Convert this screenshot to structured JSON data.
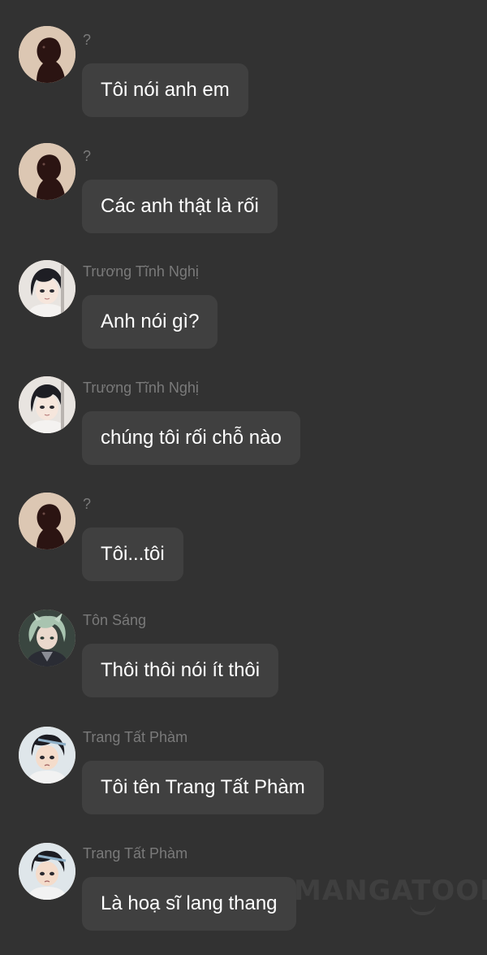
{
  "messages": [
    {
      "sender": "?",
      "text": "Tôi nói anh em",
      "avatar": "silhouette-icon"
    },
    {
      "sender": "?",
      "text": "Các anh thật là rối",
      "avatar": "silhouette-icon"
    },
    {
      "sender": "Trương Tĩnh Nghị",
      "text": "Anh nói gì?",
      "avatar": "dark-haired-character-icon"
    },
    {
      "sender": "Trương Tĩnh Nghị",
      "text": "chúng tôi rối chỗ nào",
      "avatar": "dark-haired-character-icon"
    },
    {
      "sender": "?",
      "text": "Tôi...tôi",
      "avatar": "silhouette-icon"
    },
    {
      "sender": "Tôn Sáng",
      "text": "Thôi thôi nói ít thôi",
      "avatar": "green-haired-character-icon"
    },
    {
      "sender": "Trang Tất Phàm",
      "text": "Tôi tên Trang Tất Phàm",
      "avatar": "boy-character-icon"
    },
    {
      "sender": "Trang Tất Phàm",
      "text": "Là hoạ sĩ lang thang",
      "avatar": "boy-character-icon"
    }
  ],
  "watermark": "MANGATOON",
  "colors": {
    "background": "#323232",
    "bubble": "#404040",
    "bubble_text": "#ffffff",
    "sender_name": "#7a7a7a"
  }
}
